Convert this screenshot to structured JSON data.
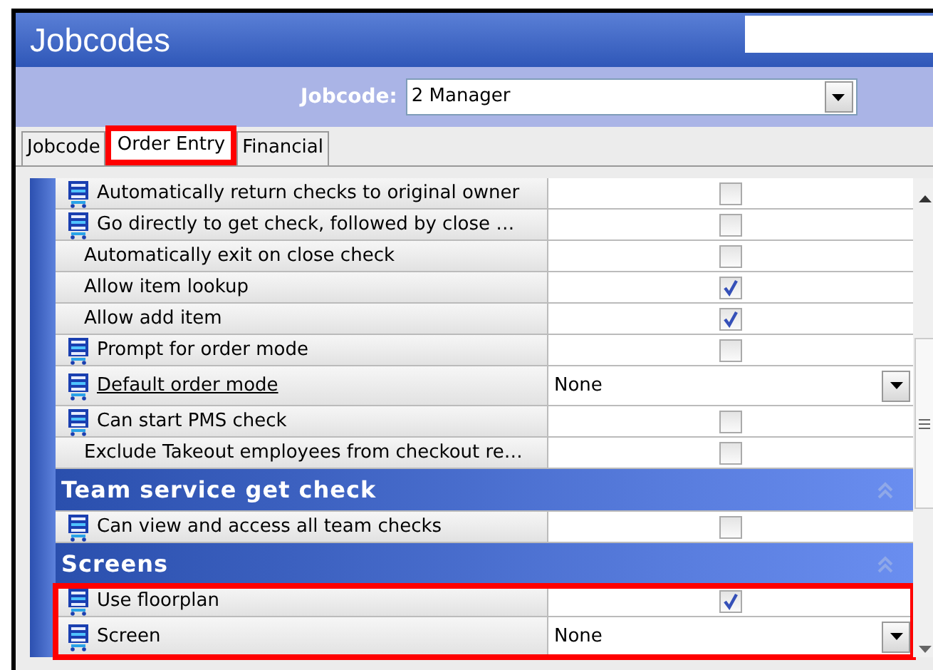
{
  "window": {
    "title": "Jobcodes"
  },
  "jobcode": {
    "label": "Jobcode:",
    "value": "2 Manager"
  },
  "tabs": [
    {
      "label": "Jobcode",
      "selected": false,
      "highlighted": false
    },
    {
      "label": "Order Entry",
      "selected": true,
      "highlighted": true
    },
    {
      "label": "Financial",
      "selected": false,
      "highlighted": false
    }
  ],
  "sections": [
    {
      "rows": [
        {
          "label": "Automatically return checks to original owner",
          "kind": "checkbox",
          "checked": false,
          "ts_icon": true,
          "underlined": false
        },
        {
          "label": "Go directly to get check, followed by close …",
          "kind": "checkbox",
          "checked": false,
          "ts_icon": true,
          "underlined": false
        },
        {
          "label": "Automatically exit on close check",
          "kind": "checkbox",
          "checked": false,
          "ts_icon": false,
          "underlined": false
        },
        {
          "label": "Allow item lookup",
          "kind": "checkbox",
          "checked": true,
          "ts_icon": false,
          "underlined": false
        },
        {
          "label": "Allow add item",
          "kind": "checkbox",
          "checked": true,
          "ts_icon": false,
          "underlined": false
        },
        {
          "label": "Prompt for order mode",
          "kind": "checkbox",
          "checked": false,
          "ts_icon": true,
          "underlined": false
        },
        {
          "label": "Default order mode",
          "kind": "dropdown",
          "value": "None",
          "ts_icon": true,
          "underlined": true
        },
        {
          "label": "Can start PMS check",
          "kind": "checkbox",
          "checked": false,
          "ts_icon": true,
          "underlined": false
        },
        {
          "label": "Exclude Takeout employees from checkout re…",
          "kind": "checkbox",
          "checked": false,
          "ts_icon": false,
          "underlined": false
        }
      ]
    },
    {
      "title": "Team service get check",
      "rows": [
        {
          "label": "Can view and access all team checks",
          "kind": "checkbox",
          "checked": false,
          "ts_icon": true,
          "underlined": false
        }
      ]
    },
    {
      "title": "Screens",
      "rows_highlighted": true,
      "rows": [
        {
          "label": "Use floorplan",
          "kind": "checkbox",
          "checked": true,
          "ts_icon": true,
          "underlined": false
        },
        {
          "label": "Screen",
          "kind": "dropdown",
          "value": "None",
          "ts_icon": true,
          "underlined": false
        }
      ]
    }
  ]
}
